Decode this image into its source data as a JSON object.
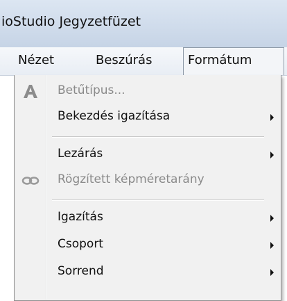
{
  "window": {
    "title": "ioStudio Jegyzetfüzet"
  },
  "menubar": {
    "items": [
      {
        "label": "Nézet"
      },
      {
        "label": "Beszúrás"
      },
      {
        "label": "Formátum"
      }
    ]
  },
  "dropdown": {
    "items": [
      {
        "label": "Betűtípus...",
        "icon": "font-icon",
        "enabled": false,
        "submenu": false
      },
      {
        "label": "Bekezdés igazítása",
        "enabled": true,
        "submenu": true
      },
      {
        "label": "Lezárás",
        "enabled": true,
        "submenu": true
      },
      {
        "label": "Rögzített képméretarány",
        "icon": "link-icon",
        "enabled": false,
        "submenu": false
      },
      {
        "label": "Igazítás",
        "enabled": true,
        "submenu": true
      },
      {
        "label": "Csoport",
        "enabled": true,
        "submenu": true
      },
      {
        "label": "Sorrend",
        "enabled": true,
        "submenu": true
      }
    ]
  }
}
